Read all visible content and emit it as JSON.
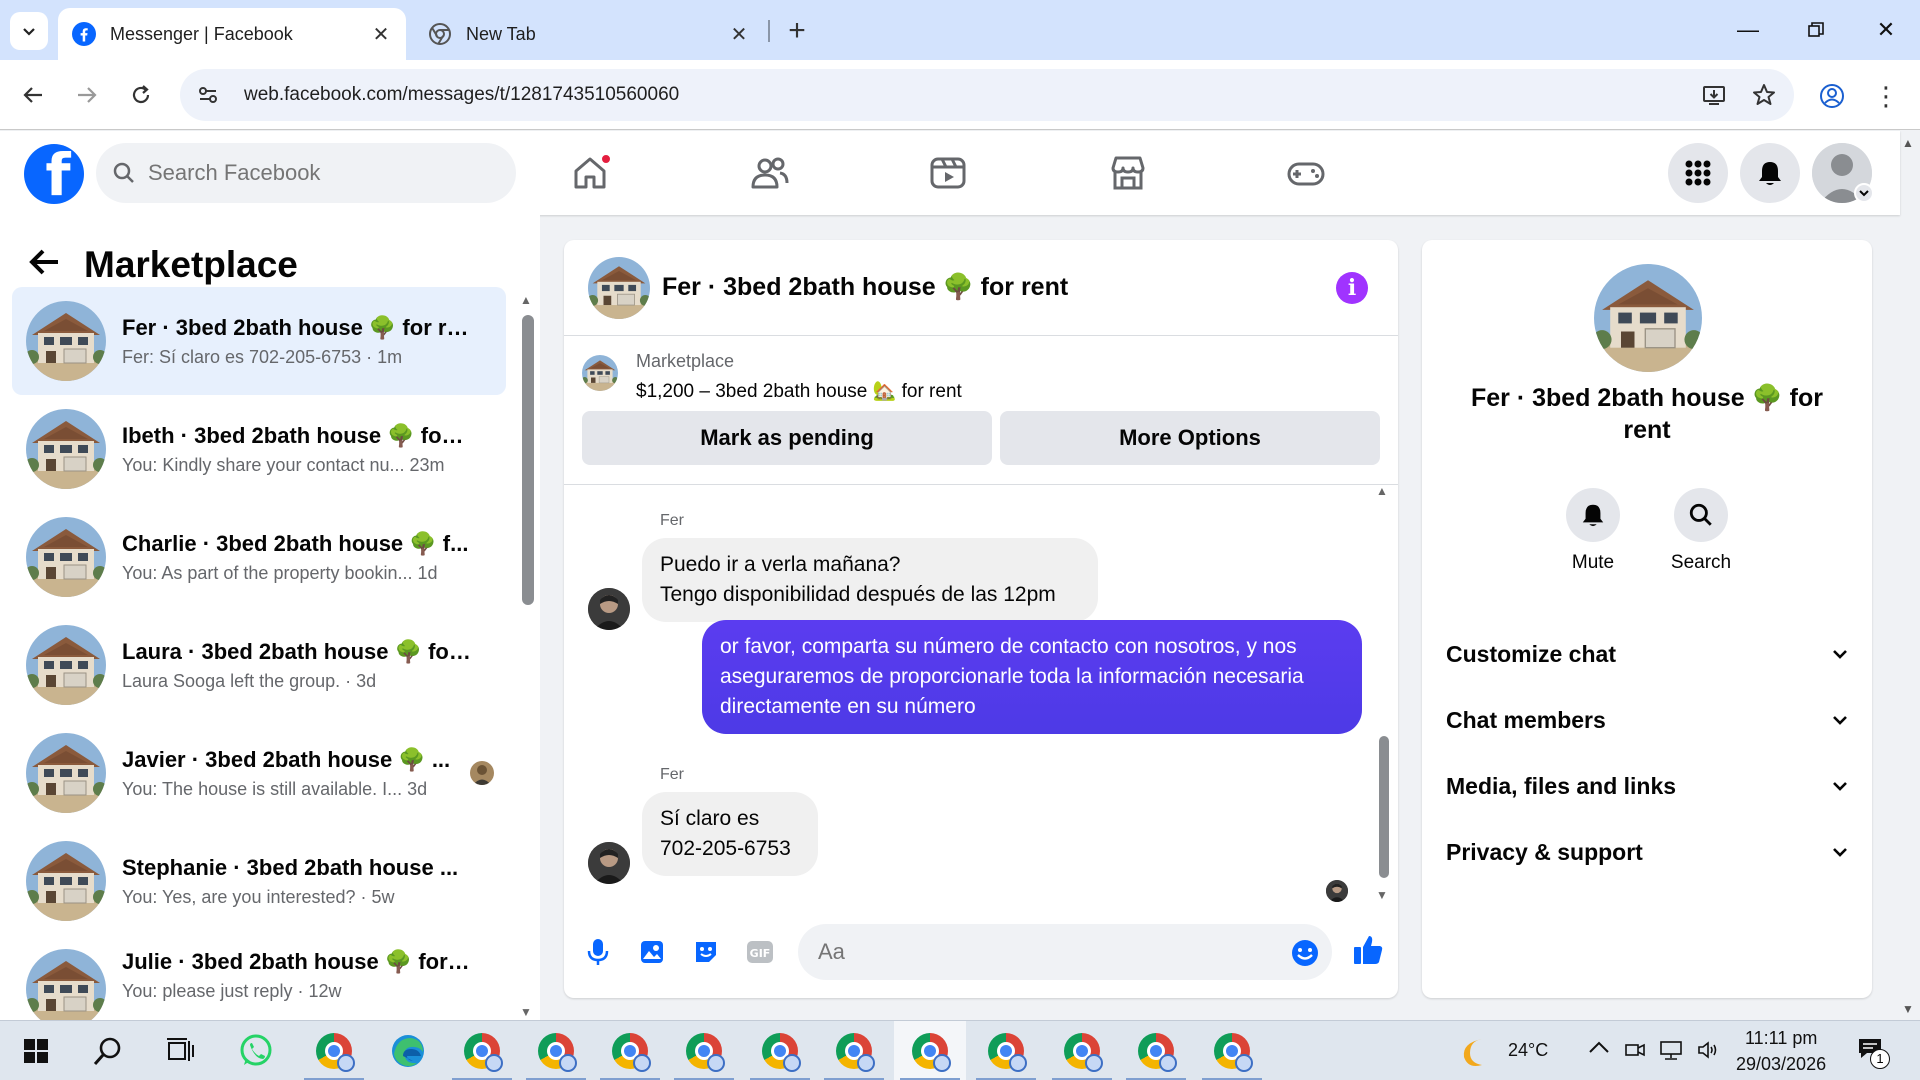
{
  "browser": {
    "tabs": [
      {
        "title": "Messenger | Facebook",
        "active": true
      },
      {
        "title": "New Tab",
        "active": false
      }
    ],
    "url": "web.facebook.com/messages/t/1281743510560060"
  },
  "fb_header": {
    "logo_letter": "f",
    "search_placeholder": "Search Facebook"
  },
  "sidebar": {
    "title": "Marketplace",
    "chats": [
      {
        "name": "Fer · 3bed 2bath house 🌳 for re...",
        "preview": "Fer: Sí claro es 702-205-6753 · 1m"
      },
      {
        "name": "Ibeth · 3bed 2bath house 🌳 for ...",
        "preview": "You: Kindly share your contact nu...  23m"
      },
      {
        "name": "Charlie · 3bed 2bath house 🌳 f...",
        "preview": "You: As part of the property bookin...  1d"
      },
      {
        "name": "Laura · 3bed 2bath house 🌳 for...",
        "preview": "Laura Sooga left the group. · 3d"
      },
      {
        "name": "Javier · 3bed 2bath house 🌳 ...",
        "preview": "You: The house is still available. I...  3d"
      },
      {
        "name": "Stephanie · 3bed 2bath house ...",
        "preview": "You: Yes, are you interested? · 5w"
      },
      {
        "name": "Julie · 3bed 2bath house 🌳 for ...",
        "preview": "You: please just reply · 12w"
      }
    ]
  },
  "conversation": {
    "title": "Fer · 3bed 2bath house 🌳 for rent",
    "marketplace_label": "Marketplace",
    "listing": "$1,200 – 3bed 2bath house 🏡 for rent",
    "buttons": {
      "pending": "Mark as pending",
      "more": "More Options"
    },
    "messages": [
      {
        "sender": "Fer",
        "lines": [
          "Puedo ir a verla mañana?",
          "Tengo disponibilidad después de las 12pm"
        ]
      },
      {
        "sender": "me",
        "text": "or favor, comparta su número de contacto con nosotros, y nos aseguraremos de proporcionarle toda la información necesaria directamente en su número"
      },
      {
        "sender": "Fer",
        "lines": [
          "Sí claro es",
          "702-205-6753"
        ]
      }
    ],
    "composer_placeholder": "Aa"
  },
  "details": {
    "name": "Fer · 3bed 2bath house 🌳 for rent",
    "actions": [
      "Mute",
      "Search"
    ],
    "sections": [
      "Customize chat",
      "Chat members",
      "Media, files and links",
      "Privacy & support"
    ]
  },
  "taskbar": {
    "weather": "24°C",
    "time": "11:11 pm",
    "date": "29/03/2026",
    "notifications": "1"
  },
  "colors": {
    "fb_blue": "#0866ff",
    "outgoing_bubble": "#4f35e8",
    "active_chat_bg": "#e7f0fd",
    "info_purple": "#a033ff"
  }
}
